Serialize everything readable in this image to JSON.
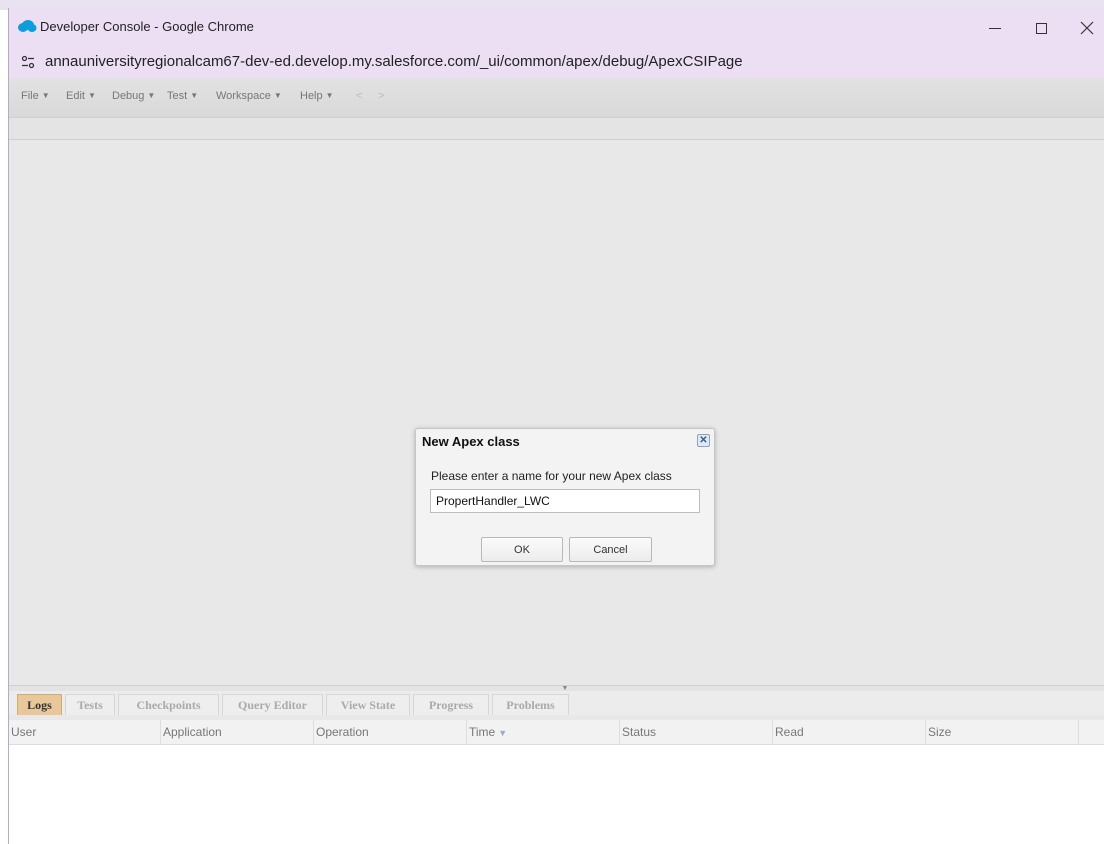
{
  "window": {
    "title": "Developer Console - Google Chrome",
    "url": "annauniversityregionalcam67-dev-ed.develop.my.salesforce.com/_ui/common/apex/debug/ApexCSIPage",
    "brand_color": "#0d9dda",
    "titlebar_color": "#ecdff4"
  },
  "menubar": {
    "items": [
      "File",
      "Edit",
      "Debug",
      "Test",
      "Workspace",
      "Help"
    ],
    "back": "<",
    "forward": ">"
  },
  "dialog": {
    "title": "New Apex class",
    "prompt": "Please enter a name for your new Apex class",
    "input_value": "PropertHandler_LWC",
    "ok_label": "OK",
    "cancel_label": "Cancel"
  },
  "bottom_panel": {
    "tabs": [
      "Logs",
      "Tests",
      "Checkpoints",
      "Query Editor",
      "View State",
      "Progress",
      "Problems"
    ],
    "active_tab": "Logs",
    "active_tab_color": "#e8c79a",
    "columns": [
      "User",
      "Application",
      "Operation",
      "Time",
      "Status",
      "Read",
      "Size"
    ],
    "sorted_column": "Time"
  }
}
